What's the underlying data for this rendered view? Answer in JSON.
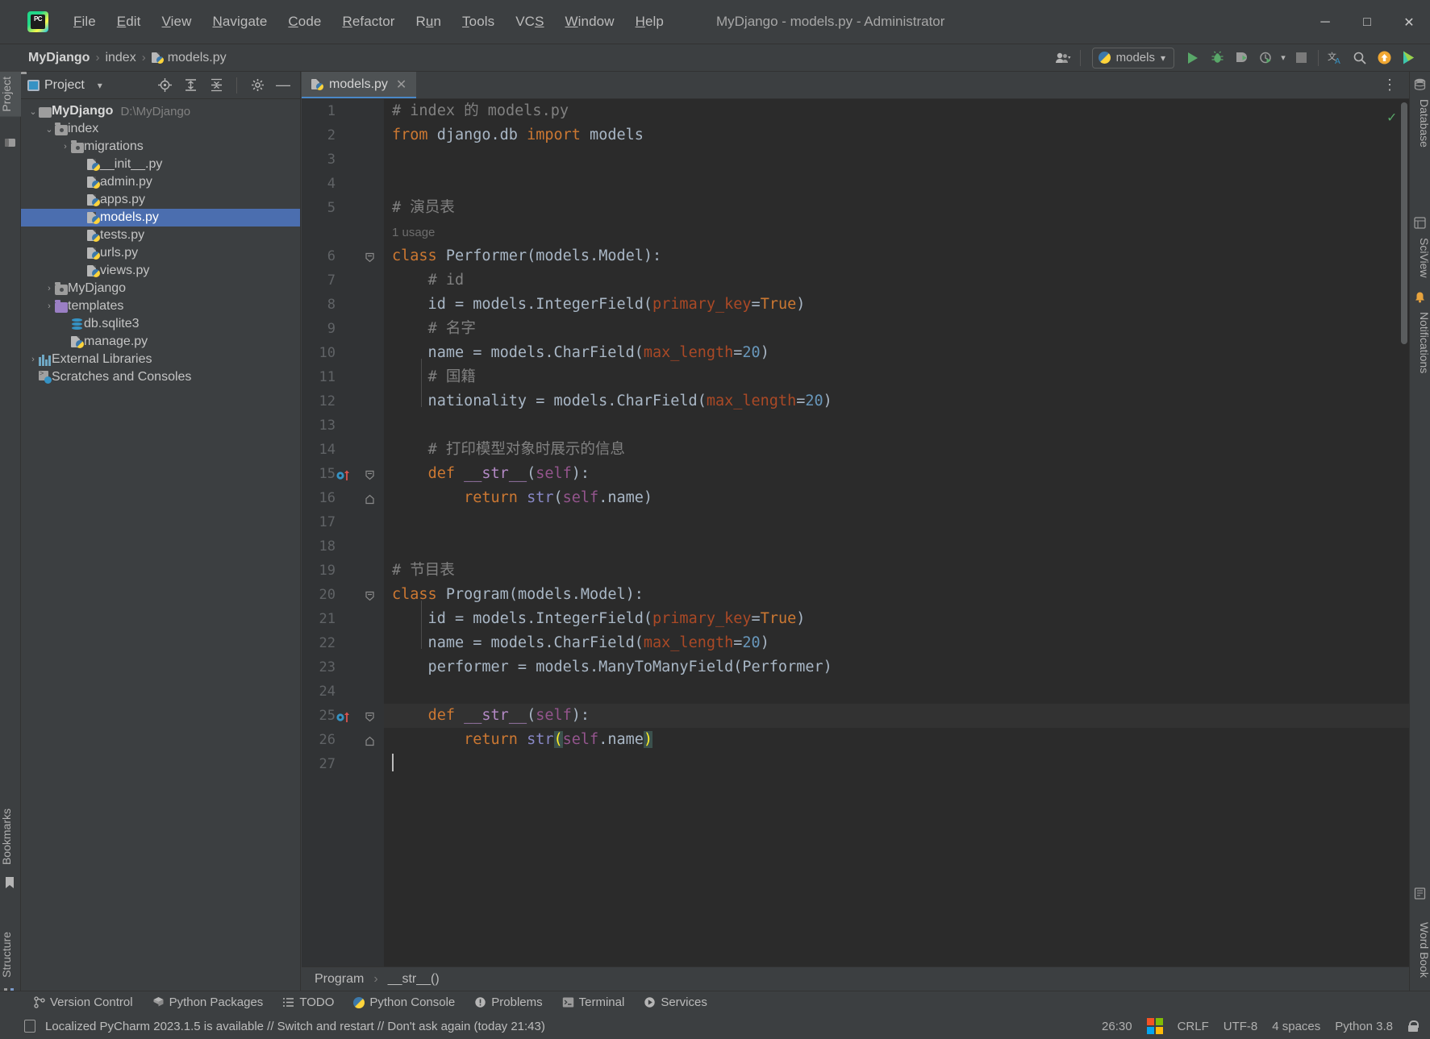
{
  "window": {
    "title": "MyDjango - models.py - Administrator",
    "minimize_label": "─",
    "maximize_label": "□",
    "close_label": "✕",
    "logo_text": "PC"
  },
  "menubar": {
    "items": [
      "File",
      "Edit",
      "View",
      "Navigate",
      "Code",
      "Refactor",
      "Run",
      "Tools",
      "VCS",
      "Window",
      "Help"
    ]
  },
  "navbar": {
    "breadcrumb": [
      {
        "label": "MyDjango",
        "bold": true,
        "icon": ""
      },
      {
        "label": "index",
        "bold": false,
        "icon": ""
      },
      {
        "label": "models.py",
        "bold": false,
        "icon": "python-file-icon"
      }
    ],
    "separator": "›",
    "run_config": {
      "label": "models",
      "icon": "python-icon",
      "chevron": "▾"
    },
    "user_icon": "user-account-icon",
    "run_icon": "run-icon",
    "debug_icon": "debug-icon",
    "coverage_icon": "run-with-coverage-icon",
    "profile_icon": "profile-icon",
    "stop_icon": "stop-icon",
    "translate_icon": "translate-icon",
    "search_icon": "search-icon",
    "update_icon": "update-arrow-icon",
    "play_store_icon": "colorful-play-icon"
  },
  "left_strip": {
    "project_label": "Project",
    "bookmarks_label": "Bookmarks",
    "structure_label": "Structure"
  },
  "right_strip": {
    "database_label": "Database",
    "sciview_label": "SciView",
    "notifications_label": "Notifications",
    "wordbook_label": "Word Book"
  },
  "project_panel": {
    "title": "Project",
    "chevron": "▾",
    "toolbar_icons": [
      "locate-icon",
      "expand-all-icon",
      "collapse-all-icon",
      "settings-gear-icon",
      "hide-icon"
    ],
    "tree": [
      {
        "label": "MyDjango",
        "sub": "D:\\MyDjango",
        "depth": 0,
        "arrow": "down",
        "icon": "folder-icon",
        "bold": true,
        "selected": false
      },
      {
        "label": "index",
        "sub": "",
        "depth": 1,
        "arrow": "down",
        "icon": "folder-package-icon",
        "bold": false,
        "selected": false
      },
      {
        "label": "migrations",
        "sub": "",
        "depth": 2,
        "arrow": "right",
        "icon": "folder-package-icon",
        "bold": false,
        "selected": false
      },
      {
        "label": "__init__.py",
        "sub": "",
        "depth": 3,
        "arrow": "none",
        "icon": "python-file-icon",
        "bold": false,
        "selected": false
      },
      {
        "label": "admin.py",
        "sub": "",
        "depth": 3,
        "arrow": "none",
        "icon": "python-file-icon",
        "bold": false,
        "selected": false
      },
      {
        "label": "apps.py",
        "sub": "",
        "depth": 3,
        "arrow": "none",
        "icon": "python-file-icon",
        "bold": false,
        "selected": false
      },
      {
        "label": "models.py",
        "sub": "",
        "depth": 3,
        "arrow": "none",
        "icon": "python-file-icon",
        "bold": false,
        "selected": true
      },
      {
        "label": "tests.py",
        "sub": "",
        "depth": 3,
        "arrow": "none",
        "icon": "python-file-icon",
        "bold": false,
        "selected": false
      },
      {
        "label": "urls.py",
        "sub": "",
        "depth": 3,
        "arrow": "none",
        "icon": "python-file-icon",
        "bold": false,
        "selected": false
      },
      {
        "label": "views.py",
        "sub": "",
        "depth": 3,
        "arrow": "none",
        "icon": "python-file-icon",
        "bold": false,
        "selected": false
      },
      {
        "label": "MyDjango",
        "sub": "",
        "depth": 1,
        "arrow": "right",
        "icon": "folder-package-icon",
        "bold": false,
        "selected": false
      },
      {
        "label": "templates",
        "sub": "",
        "depth": 1,
        "arrow": "right",
        "icon": "folder-purple-icon",
        "bold": false,
        "selected": false
      },
      {
        "label": "db.sqlite3",
        "sub": "",
        "depth": 2,
        "arrow": "none",
        "icon": "database-icon",
        "bold": false,
        "selected": false
      },
      {
        "label": "manage.py",
        "sub": "",
        "depth": 2,
        "arrow": "none",
        "icon": "python-file-icon",
        "bold": false,
        "selected": false
      },
      {
        "label": "External Libraries",
        "sub": "",
        "depth": 0,
        "arrow": "right",
        "icon": "libraries-icon",
        "bold": false,
        "selected": false
      },
      {
        "label": "Scratches and Consoles",
        "sub": "",
        "depth": 0,
        "arrow": "none",
        "icon": "scratches-icon",
        "bold": false,
        "selected": false
      }
    ]
  },
  "editor": {
    "tab": {
      "label": "models.py",
      "icon": "python-file-icon",
      "close": "✕"
    },
    "options_icon": "more-options-icon",
    "inspection_status": "✓",
    "line_numbers": [
      "1",
      "2",
      "3",
      "4",
      "5",
      "6",
      "7",
      "8",
      "9",
      "10",
      "11",
      "12",
      "13",
      "14",
      "15",
      "16",
      "17",
      "18",
      "19",
      "20",
      "21",
      "22",
      "23",
      "24",
      "25",
      "26",
      "27"
    ],
    "usage_hint": "1 usage",
    "lines": [
      {
        "n": 1,
        "text": "# index 的 models.py"
      },
      {
        "n": 2,
        "text": "from django.db import models"
      },
      {
        "n": 3,
        "text": ""
      },
      {
        "n": 4,
        "text": ""
      },
      {
        "n": 5,
        "text": "# 演员表"
      },
      {
        "n": 6,
        "text": "class Performer(models.Model):"
      },
      {
        "n": 7,
        "text": "    # id"
      },
      {
        "n": 8,
        "text": "    id = models.IntegerField(primary_key=True)"
      },
      {
        "n": 9,
        "text": "    # 名字"
      },
      {
        "n": 10,
        "text": "    name = models.CharField(max_length=20)"
      },
      {
        "n": 11,
        "text": "    # 国籍"
      },
      {
        "n": 12,
        "text": "    nationality = models.CharField(max_length=20)"
      },
      {
        "n": 13,
        "text": ""
      },
      {
        "n": 14,
        "text": "    # 打印模型对象时展示的信息"
      },
      {
        "n": 15,
        "text": "    def __str__(self):"
      },
      {
        "n": 16,
        "text": "        return str(self.name)"
      },
      {
        "n": 17,
        "text": ""
      },
      {
        "n": 18,
        "text": ""
      },
      {
        "n": 19,
        "text": "# 节目表"
      },
      {
        "n": 20,
        "text": "class Program(models.Model):"
      },
      {
        "n": 21,
        "text": "    id = models.IntegerField(primary_key=True)"
      },
      {
        "n": 22,
        "text": "    name = models.CharField(max_length=20)"
      },
      {
        "n": 23,
        "text": "    performer = models.ManyToManyField(Performer)"
      },
      {
        "n": 24,
        "text": ""
      },
      {
        "n": 25,
        "text": "    def __str__(self):"
      },
      {
        "n": 26,
        "text": "        return str(self.name)"
      },
      {
        "n": 27,
        "text": ""
      }
    ],
    "footer_breadcrumb": [
      "Program",
      "__str__()"
    ],
    "footer_separator": "›"
  },
  "bottom_tabs": [
    {
      "label": "Version Control",
      "icon": "branch-icon"
    },
    {
      "label": "Python Packages",
      "icon": "packages-icon"
    },
    {
      "label": "TODO",
      "icon": "todo-list-icon"
    },
    {
      "label": "Python Console",
      "icon": "python-console-icon"
    },
    {
      "label": "Problems",
      "icon": "problems-icon"
    },
    {
      "label": "Terminal",
      "icon": "terminal-icon"
    },
    {
      "label": "Services",
      "icon": "services-icon"
    }
  ],
  "statusbar": {
    "message": "Localized PyCharm 2023.1.5 is available // Switch and restart // Don't ask again (today 21:43)",
    "message_icon": "document-icon",
    "caret_position": "26:30",
    "line_separator": "CRLF",
    "encoding": "UTF-8",
    "indent": "4 spaces",
    "interpreter": "Python 3.8",
    "lock_icon": "unlocked-icon",
    "ms_logo_icon": "windows-logo-icon"
  },
  "colors": {
    "accent_blue": "#4b6eaf",
    "bg_panel": "#3c3f41",
    "bg_editor": "#2b2b2b",
    "keyword_orange": "#cc7832",
    "function_yellow": "#ffc66d",
    "number_blue": "#6897bb",
    "comment_gray": "#808080",
    "param_red": "#aa4926",
    "self_purple": "#94558d",
    "builtin_violet": "#8888c6",
    "green_run": "#59a869"
  }
}
